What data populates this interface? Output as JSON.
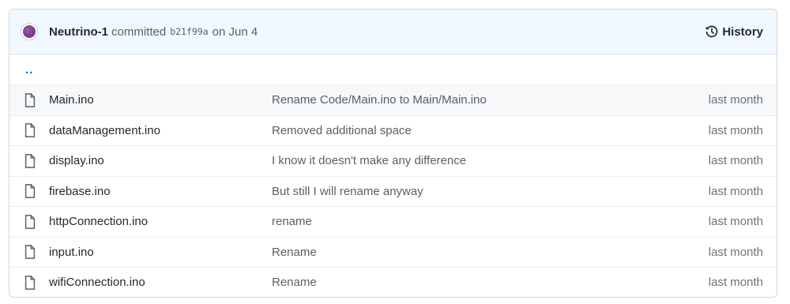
{
  "commit": {
    "author": "Neutrino-1",
    "verb": "committed",
    "sha": "b21f99a",
    "date": "on Jun 4"
  },
  "history_label": "History",
  "parent_dir": "..",
  "files": [
    {
      "name": "Main.ino",
      "message": "Rename Code/Main.ino to Main/Main.ino",
      "age": "last month"
    },
    {
      "name": "dataManagement.ino",
      "message": "Removed additional space",
      "age": "last month"
    },
    {
      "name": "display.ino",
      "message": "I know it doesn't make any difference",
      "age": "last month"
    },
    {
      "name": "firebase.ino",
      "message": "But still I will rename anyway",
      "age": "last month"
    },
    {
      "name": "httpConnection.ino",
      "message": "rename",
      "age": "last month"
    },
    {
      "name": "input.ino",
      "message": "Rename",
      "age": "last month"
    },
    {
      "name": "wifiConnection.ino",
      "message": "Rename",
      "age": "last month"
    }
  ],
  "icons": {
    "file": "file-icon",
    "history": "history-icon",
    "avatar": "avatar"
  }
}
